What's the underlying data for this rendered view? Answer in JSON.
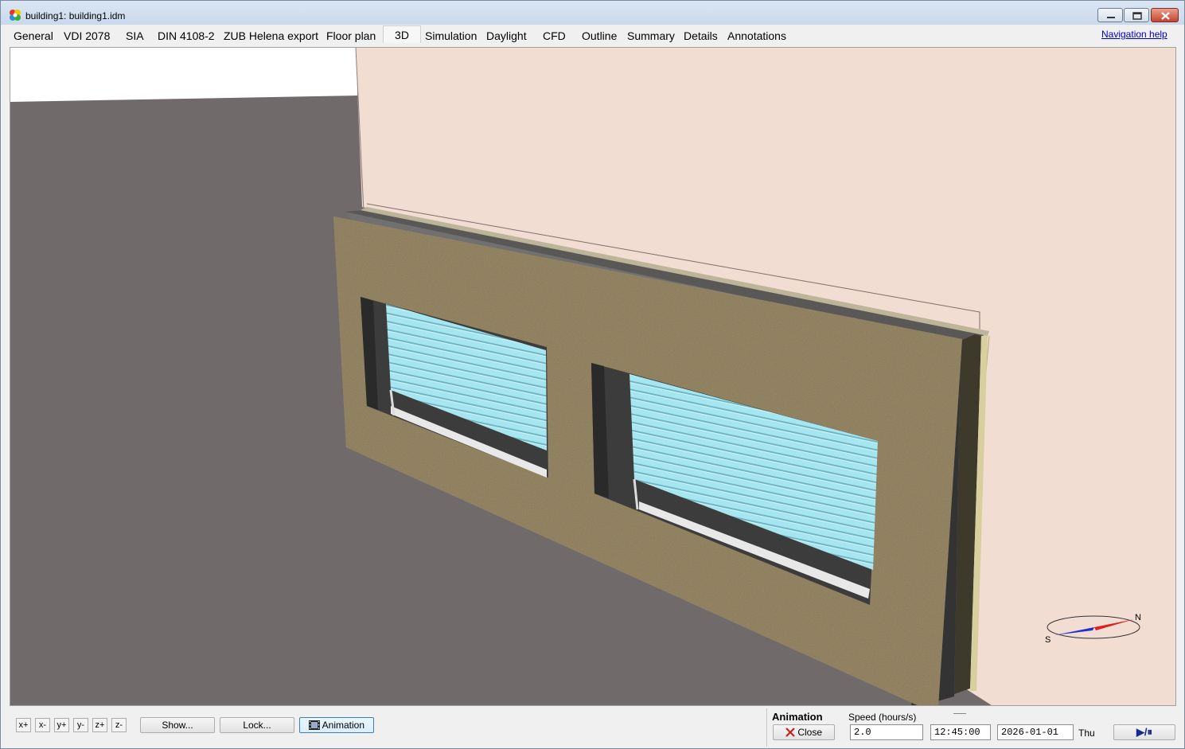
{
  "window": {
    "title": "building1: building1.idm",
    "icon": "app-flower-icon"
  },
  "tabs": [
    {
      "label": "General"
    },
    {
      "label": "VDI 2078"
    },
    {
      "label": "SIA"
    },
    {
      "label": "DIN 4108-2"
    },
    {
      "label": "ZUB Helena export"
    },
    {
      "label": "Floor plan"
    },
    {
      "label": "3D",
      "active": true
    },
    {
      "label": "Simulation"
    },
    {
      "label": "Daylight"
    },
    {
      "label": "CFD"
    },
    {
      "label": "Outline"
    },
    {
      "label": "Summary"
    },
    {
      "label": "Details"
    },
    {
      "label": "Annotations"
    }
  ],
  "nav_help": "Navigation help",
  "compass": {
    "north": "N",
    "south": "S"
  },
  "view_buttons": [
    "x+",
    "x-",
    "y+",
    "y-",
    "z+",
    "z-"
  ],
  "toolbar": {
    "show": "Show...",
    "lock": "Lock...",
    "animation": "Animation"
  },
  "animation": {
    "title": "Animation",
    "close": "Close",
    "speed_label": "Speed (hours/s)",
    "speed": "2.0",
    "time": "12:45:00",
    "date": "2026-01-01",
    "weekday": "Thu",
    "play_pause": "▶/⏸"
  },
  "colors": {
    "ground": "#706b6a",
    "back_wall": "#f3ddd4",
    "stucco": "#9a8a68",
    "blinds": "#9fe0ec",
    "frame": "#3a3a3a"
  }
}
